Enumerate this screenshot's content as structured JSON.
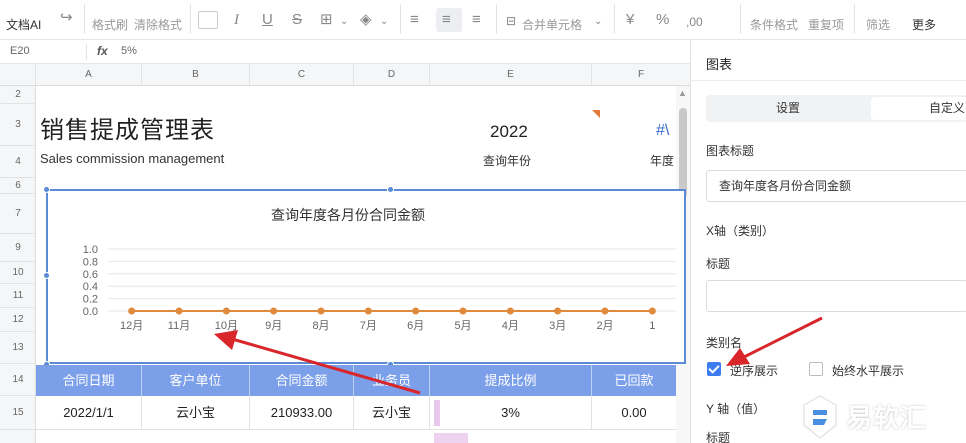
{
  "toolbar": {
    "doc_ai": "文档AI",
    "format_brush": "格式刷",
    "clear_format": "清除格式",
    "merge_cells": "合并单元格",
    "conditional_format": "条件格式",
    "duplicates": "重复项",
    "filter": "筛选",
    "more": "更多"
  },
  "formula_bar": {
    "cell_ref": "E20",
    "fx": "fx",
    "value": "5%"
  },
  "columns": [
    "A",
    "B",
    "C",
    "D",
    "E",
    "F"
  ],
  "rows": [
    "2",
    "3",
    "4",
    "6",
    "7",
    "9",
    "10",
    "11",
    "12",
    "13",
    "14",
    "15"
  ],
  "sheet": {
    "title": "销售提成管理表",
    "subtitle": "Sales commission management",
    "year": "2022",
    "year_label": "查询年份",
    "hash_cut": "#\\",
    "year_label_cut": "年度"
  },
  "chart_data": {
    "type": "line",
    "title": "查询年度各月份合同金额",
    "categories": [
      "12月",
      "11月",
      "10月",
      "9月",
      "8月",
      "7月",
      "6月",
      "5月",
      "4月",
      "3月",
      "2月",
      "1"
    ],
    "series": [
      {
        "values": [
          0,
          0,
          0,
          0,
          0,
          0,
          0,
          0,
          0,
          0,
          0,
          0
        ],
        "color": "#e08a3c"
      }
    ],
    "yticks": [
      "1.0",
      "0.8",
      "0.6",
      "0.4",
      "0.2",
      "0.0"
    ],
    "ylim": [
      0,
      1
    ],
    "grid": true
  },
  "table": {
    "headers": [
      "合同日期",
      "客户单位",
      "合同金额",
      "业务员",
      "提成比例",
      "已回款"
    ],
    "rows": [
      [
        "2022/1/1",
        "云小宝",
        "210933.00",
        "云小宝",
        "3%",
        "0.00"
      ]
    ]
  },
  "panel": {
    "heading": "图表",
    "tab_settings": "设置",
    "tab_custom": "自定义",
    "chart_title_label": "图表标题",
    "chart_title_value": "查询年度各月份合同金额",
    "xaxis_label": "X轴（类别）",
    "title_label": "标题",
    "x_title_value": "",
    "category_name_label": "类别名",
    "reverse_label": "逆序展示",
    "reverse_checked": true,
    "always_horizontal_label": "始终水平展示",
    "always_horizontal_checked": false,
    "yaxis_label": "Y 轴（值）",
    "y_title_label": "标题"
  },
  "colors": {
    "accent": "#3d7cf0",
    "table_header": "#7b9fe8",
    "chart_frame": "#5b8bd6",
    "series": "#e08a3c",
    "arrow": "#d8262b"
  },
  "watermark": {
    "text": "易软汇"
  }
}
